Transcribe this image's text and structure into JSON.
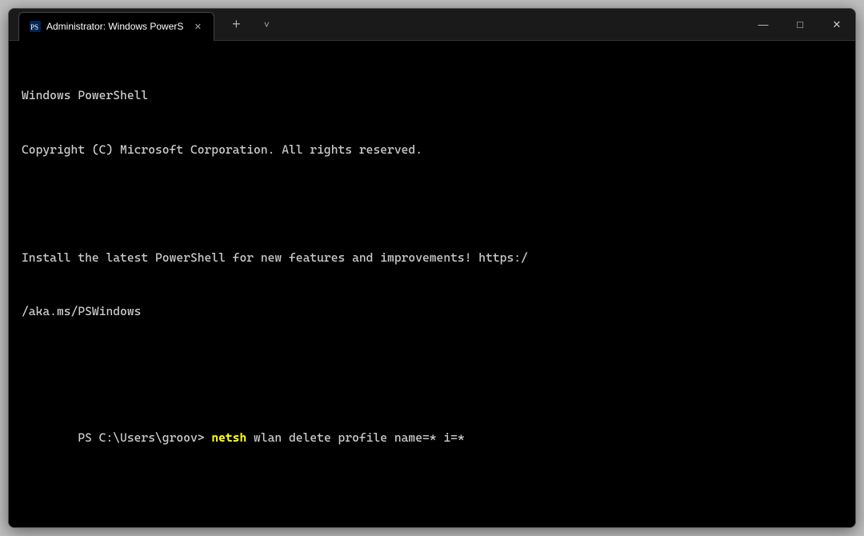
{
  "window": {
    "title": "Administrator: Windows PowerShell",
    "tab_label": "Administrator: Windows PowerS"
  },
  "titlebar": {
    "new_tab_label": "+",
    "dropdown_label": "˅",
    "minimize_label": "—",
    "maximize_label": "□",
    "close_label": "✕"
  },
  "terminal": {
    "line1": "Windows PowerShell",
    "line2": "Copyright (C) Microsoft Corporation. All rights reserved.",
    "line3": "",
    "line4": "Install the latest PowerShell for new features and improvements! https:/",
    "line5": "/aka.ms/PSWindows",
    "line6": "",
    "prompt": "PS C:\\Users\\groov> ",
    "command": "netsh",
    "args": " wlan delete profile name=* i=*"
  }
}
